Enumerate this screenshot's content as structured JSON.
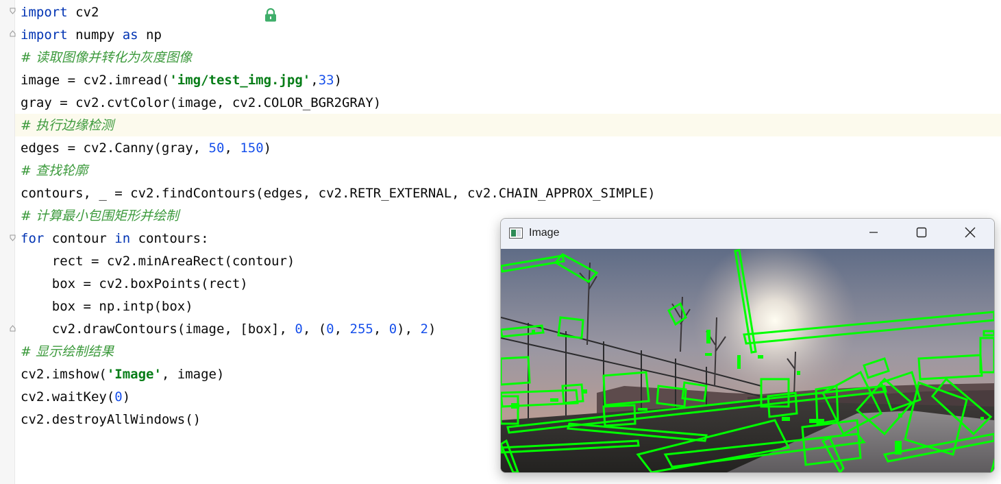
{
  "editor": {
    "lines": [
      {
        "parts": [
          {
            "t": "import",
            "c": "kw"
          },
          {
            "t": " cv2",
            "c": ""
          }
        ]
      },
      {
        "parts": [
          {
            "t": "import",
            "c": "kw"
          },
          {
            "t": " numpy ",
            "c": ""
          },
          {
            "t": "as",
            "c": "kw"
          },
          {
            "t": " np",
            "c": ""
          }
        ]
      },
      {
        "parts": [
          {
            "t": "# 读取图像并转化为灰度图像",
            "c": "cm-green"
          }
        ]
      },
      {
        "parts": [
          {
            "t": "image = cv2.imread(",
            "c": ""
          },
          {
            "t": "'img/test_img.jpg'",
            "c": "str"
          },
          {
            "t": ",",
            "c": ""
          },
          {
            "t": "33",
            "c": "num"
          },
          {
            "t": ")",
            "c": ""
          }
        ]
      },
      {
        "parts": [
          {
            "t": "gray = cv2.cvtColor(image, cv2.COLOR_BGR2GRAY)",
            "c": ""
          }
        ]
      },
      {
        "parts": [
          {
            "t": "# 执行边缘检测",
            "c": "cm-green"
          }
        ]
      },
      {
        "parts": [
          {
            "t": "edges = cv2.Canny(gray, ",
            "c": ""
          },
          {
            "t": "50",
            "c": "num"
          },
          {
            "t": ", ",
            "c": ""
          },
          {
            "t": "150",
            "c": "num"
          },
          {
            "t": ")",
            "c": ""
          }
        ]
      },
      {
        "parts": [
          {
            "t": "# 查找轮廓",
            "c": "cm-green"
          }
        ]
      },
      {
        "parts": [
          {
            "t": "contours, _ = cv2.findContours(edges, cv2.RETR_EXTERNAL, cv2.CHAIN_APPROX_SIMPLE)",
            "c": ""
          }
        ]
      },
      {
        "parts": [
          {
            "t": "# 计算最小包围矩形并绘制",
            "c": "cm-green"
          }
        ]
      },
      {
        "parts": [
          {
            "t": "for",
            "c": "kw"
          },
          {
            "t": " contour ",
            "c": ""
          },
          {
            "t": "in",
            "c": "kw"
          },
          {
            "t": " contours:",
            "c": ""
          }
        ]
      },
      {
        "parts": [
          {
            "t": "    rect = cv2.minAreaRect(contour)",
            "c": ""
          }
        ]
      },
      {
        "parts": [
          {
            "t": "    box = cv2.boxPoints(rect)",
            "c": ""
          }
        ]
      },
      {
        "parts": [
          {
            "t": "    box = np.intp(box)",
            "c": ""
          }
        ]
      },
      {
        "parts": [
          {
            "t": "    cv2.drawContours(image, [box], ",
            "c": ""
          },
          {
            "t": "0",
            "c": "num"
          },
          {
            "t": ", (",
            "c": ""
          },
          {
            "t": "0",
            "c": "num"
          },
          {
            "t": ", ",
            "c": ""
          },
          {
            "t": "255",
            "c": "num"
          },
          {
            "t": ", ",
            "c": ""
          },
          {
            "t": "0",
            "c": "num"
          },
          {
            "t": "), ",
            "c": ""
          },
          {
            "t": "2",
            "c": "num"
          },
          {
            "t": ")",
            "c": ""
          }
        ]
      },
      {
        "parts": [
          {
            "t": "# 显示绘制结果",
            "c": "cm-green"
          }
        ]
      },
      {
        "parts": [
          {
            "t": "cv2.imshow(",
            "c": ""
          },
          {
            "t": "'Image'",
            "c": "str"
          },
          {
            "t": ", image)",
            "c": ""
          }
        ]
      },
      {
        "parts": [
          {
            "t": "cv2.waitKey(",
            "c": ""
          },
          {
            "t": "0",
            "c": "num"
          },
          {
            "t": ")",
            "c": ""
          }
        ]
      },
      {
        "parts": [
          {
            "t": "cv2.destroyAllWindows()",
            "c": ""
          }
        ]
      }
    ]
  },
  "window": {
    "title": "Image",
    "minimize_icon": "minimize-icon",
    "maximize_icon": "maximize-icon",
    "close_icon": "close-icon"
  },
  "colors": {
    "keyword": "#0033b3",
    "string": "#067d17",
    "number": "#1750eb",
    "comment": "#3c9a3c",
    "contour": "#00ff00"
  }
}
